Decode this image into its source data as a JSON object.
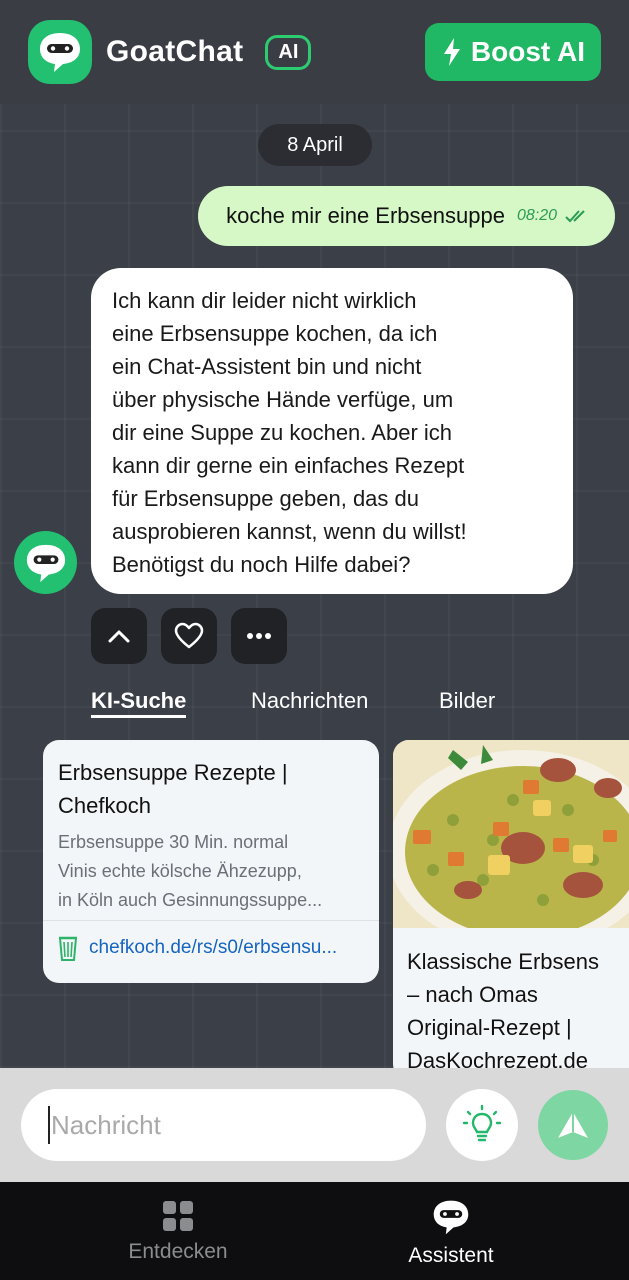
{
  "header": {
    "app_name": "GoatChat",
    "ai_badge": "AI",
    "boost_label": "Boost AI",
    "brand_color": "#22c070"
  },
  "chat": {
    "date_label": "8 April",
    "user_message": {
      "text": "koche mir eine Erbsensuppe",
      "time": "08:20",
      "status_icon": "double-check-icon"
    },
    "assistant_message": {
      "lines": [
        "Ich kann dir leider nicht wirklich",
        "eine Erbsensuppe kochen, da ich",
        "ein Chat-Assistent bin und nicht",
        "über physische Hände verfüge, um",
        "dir eine Suppe zu kochen. Aber ich",
        "kann dir gerne ein einfaches Rezept",
        "für Erbsensuppe geben, das du",
        "ausprobieren kannst, wenn du willst!",
        "Benötigst du noch Hilfe dabei?"
      ]
    },
    "actions": [
      "chevron-up-icon",
      "heart-icon",
      "more-icon"
    ]
  },
  "tabs": [
    {
      "label": "KI-Suche",
      "active": true
    },
    {
      "label": "Nachrichten",
      "active": false
    },
    {
      "label": "Bilder",
      "active": false
    }
  ],
  "results": {
    "card1": {
      "title_lines": [
        "Erbsensuppe Rezepte |",
        "Chefkoch"
      ],
      "desc_lines": [
        "Erbsensuppe 30 Min. normal",
        "Vinis echte kölsche Ähzezupp,",
        "in Köln auch Gesinnungssuppe..."
      ],
      "link": "chefkoch.de/rs/s0/erbsensu..."
    },
    "card2": {
      "title_lines": [
        "Klassische Erbsens",
        "– nach Omas",
        "Original-Rezept |",
        "DasKochrezept.de"
      ]
    }
  },
  "composer": {
    "placeholder": "Nachricht"
  },
  "bottom_nav": [
    {
      "label": "Entdecken",
      "icon": "grid-icon",
      "active": false
    },
    {
      "label": "Assistent",
      "icon": "chat-bot-icon",
      "active": true
    }
  ]
}
